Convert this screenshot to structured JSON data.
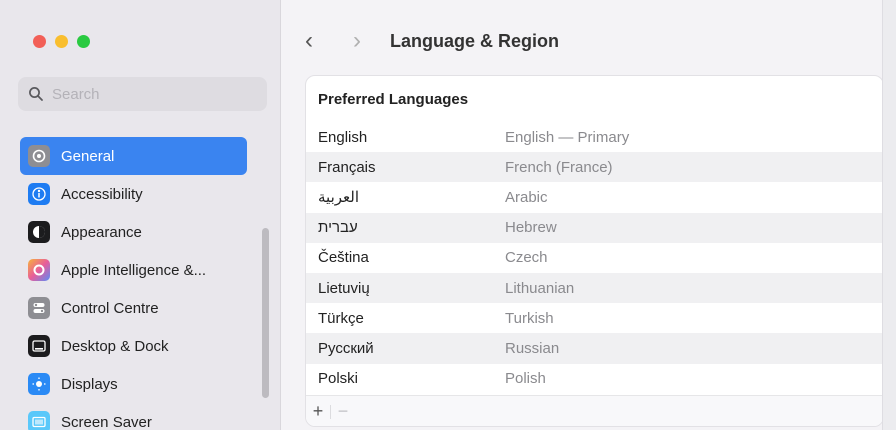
{
  "window": {
    "title": "Language & Region"
  },
  "sidebar": {
    "search_placeholder": "Search",
    "items": [
      {
        "label": "General",
        "icon": "gear-icon",
        "color": "#8e8e93",
        "selected": true
      },
      {
        "label": "Accessibility",
        "icon": "accessibility-icon",
        "color": "#1e7cf2",
        "selected": false
      },
      {
        "label": "Appearance",
        "icon": "appearance-icon",
        "color": "#1c1c1e",
        "selected": false
      },
      {
        "label": "Apple Intelligence &...",
        "icon": "apple-intelligence-icon",
        "color": "#e85d9a",
        "selected": false
      },
      {
        "label": "Control Centre",
        "icon": "control-centre-icon",
        "color": "#8e8e93",
        "selected": false
      },
      {
        "label": "Desktop & Dock",
        "icon": "desktop-dock-icon",
        "color": "#1c1c1e",
        "selected": false
      },
      {
        "label": "Displays",
        "icon": "displays-icon",
        "color": "#2a8af5",
        "selected": false
      },
      {
        "label": "Screen Saver",
        "icon": "screen-saver-icon",
        "color": "#5ac8fa",
        "selected": false
      }
    ]
  },
  "main": {
    "panel_title": "Preferred Languages",
    "languages": [
      {
        "native": "English",
        "description": "English — Primary"
      },
      {
        "native": "Français",
        "description": "French (France)"
      },
      {
        "native": "العربية",
        "description": "Arabic"
      },
      {
        "native": "עברית",
        "description": "Hebrew"
      },
      {
        "native": "Čeština",
        "description": "Czech"
      },
      {
        "native": "Lietuvių",
        "description": "Lithuanian"
      },
      {
        "native": "Türkçe",
        "description": "Turkish"
      },
      {
        "native": "Русский",
        "description": "Russian"
      },
      {
        "native": "Polski",
        "description": "Polish"
      }
    ],
    "add_label": "+",
    "remove_label": "−"
  }
}
